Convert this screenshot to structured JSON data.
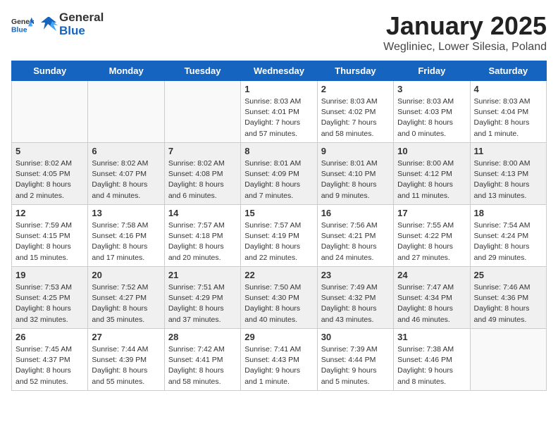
{
  "header": {
    "logo_general": "General",
    "logo_blue": "Blue",
    "month": "January 2025",
    "location": "Wegliniec, Lower Silesia, Poland"
  },
  "days_of_week": [
    "Sunday",
    "Monday",
    "Tuesday",
    "Wednesday",
    "Thursday",
    "Friday",
    "Saturday"
  ],
  "weeks": [
    [
      {
        "day": "",
        "info": ""
      },
      {
        "day": "",
        "info": ""
      },
      {
        "day": "",
        "info": ""
      },
      {
        "day": "1",
        "info": "Sunrise: 8:03 AM\nSunset: 4:01 PM\nDaylight: 7 hours and 57 minutes."
      },
      {
        "day": "2",
        "info": "Sunrise: 8:03 AM\nSunset: 4:02 PM\nDaylight: 7 hours and 58 minutes."
      },
      {
        "day": "3",
        "info": "Sunrise: 8:03 AM\nSunset: 4:03 PM\nDaylight: 8 hours and 0 minutes."
      },
      {
        "day": "4",
        "info": "Sunrise: 8:03 AM\nSunset: 4:04 PM\nDaylight: 8 hours and 1 minute."
      }
    ],
    [
      {
        "day": "5",
        "info": "Sunrise: 8:02 AM\nSunset: 4:05 PM\nDaylight: 8 hours and 2 minutes."
      },
      {
        "day": "6",
        "info": "Sunrise: 8:02 AM\nSunset: 4:07 PM\nDaylight: 8 hours and 4 minutes."
      },
      {
        "day": "7",
        "info": "Sunrise: 8:02 AM\nSunset: 4:08 PM\nDaylight: 8 hours and 6 minutes."
      },
      {
        "day": "8",
        "info": "Sunrise: 8:01 AM\nSunset: 4:09 PM\nDaylight: 8 hours and 7 minutes."
      },
      {
        "day": "9",
        "info": "Sunrise: 8:01 AM\nSunset: 4:10 PM\nDaylight: 8 hours and 9 minutes."
      },
      {
        "day": "10",
        "info": "Sunrise: 8:00 AM\nSunset: 4:12 PM\nDaylight: 8 hours and 11 minutes."
      },
      {
        "day": "11",
        "info": "Sunrise: 8:00 AM\nSunset: 4:13 PM\nDaylight: 8 hours and 13 minutes."
      }
    ],
    [
      {
        "day": "12",
        "info": "Sunrise: 7:59 AM\nSunset: 4:15 PM\nDaylight: 8 hours and 15 minutes."
      },
      {
        "day": "13",
        "info": "Sunrise: 7:58 AM\nSunset: 4:16 PM\nDaylight: 8 hours and 17 minutes."
      },
      {
        "day": "14",
        "info": "Sunrise: 7:57 AM\nSunset: 4:18 PM\nDaylight: 8 hours and 20 minutes."
      },
      {
        "day": "15",
        "info": "Sunrise: 7:57 AM\nSunset: 4:19 PM\nDaylight: 8 hours and 22 minutes."
      },
      {
        "day": "16",
        "info": "Sunrise: 7:56 AM\nSunset: 4:21 PM\nDaylight: 8 hours and 24 minutes."
      },
      {
        "day": "17",
        "info": "Sunrise: 7:55 AM\nSunset: 4:22 PM\nDaylight: 8 hours and 27 minutes."
      },
      {
        "day": "18",
        "info": "Sunrise: 7:54 AM\nSunset: 4:24 PM\nDaylight: 8 hours and 29 minutes."
      }
    ],
    [
      {
        "day": "19",
        "info": "Sunrise: 7:53 AM\nSunset: 4:25 PM\nDaylight: 8 hours and 32 minutes."
      },
      {
        "day": "20",
        "info": "Sunrise: 7:52 AM\nSunset: 4:27 PM\nDaylight: 8 hours and 35 minutes."
      },
      {
        "day": "21",
        "info": "Sunrise: 7:51 AM\nSunset: 4:29 PM\nDaylight: 8 hours and 37 minutes."
      },
      {
        "day": "22",
        "info": "Sunrise: 7:50 AM\nSunset: 4:30 PM\nDaylight: 8 hours and 40 minutes."
      },
      {
        "day": "23",
        "info": "Sunrise: 7:49 AM\nSunset: 4:32 PM\nDaylight: 8 hours and 43 minutes."
      },
      {
        "day": "24",
        "info": "Sunrise: 7:47 AM\nSunset: 4:34 PM\nDaylight: 8 hours and 46 minutes."
      },
      {
        "day": "25",
        "info": "Sunrise: 7:46 AM\nSunset: 4:36 PM\nDaylight: 8 hours and 49 minutes."
      }
    ],
    [
      {
        "day": "26",
        "info": "Sunrise: 7:45 AM\nSunset: 4:37 PM\nDaylight: 8 hours and 52 minutes."
      },
      {
        "day": "27",
        "info": "Sunrise: 7:44 AM\nSunset: 4:39 PM\nDaylight: 8 hours and 55 minutes."
      },
      {
        "day": "28",
        "info": "Sunrise: 7:42 AM\nSunset: 4:41 PM\nDaylight: 8 hours and 58 minutes."
      },
      {
        "day": "29",
        "info": "Sunrise: 7:41 AM\nSunset: 4:43 PM\nDaylight: 9 hours and 1 minute."
      },
      {
        "day": "30",
        "info": "Sunrise: 7:39 AM\nSunset: 4:44 PM\nDaylight: 9 hours and 5 minutes."
      },
      {
        "day": "31",
        "info": "Sunrise: 7:38 AM\nSunset: 4:46 PM\nDaylight: 9 hours and 8 minutes."
      },
      {
        "day": "",
        "info": ""
      }
    ]
  ]
}
